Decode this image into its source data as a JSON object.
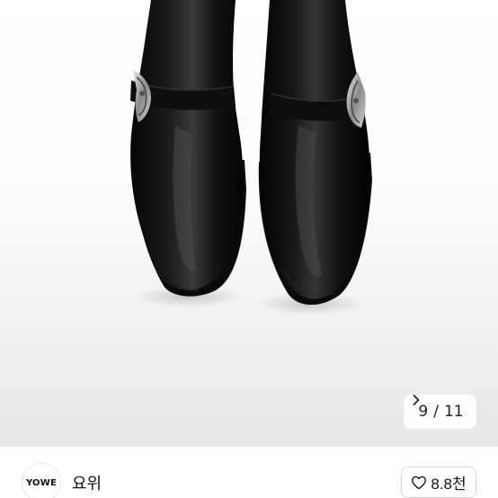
{
  "gallery": {
    "image_alt": "",
    "current": "9",
    "separator": "/",
    "total": "11",
    "next_icon": "chevron-right-icon"
  },
  "shop": {
    "logo_text": "YOWE",
    "name": "요위"
  },
  "like": {
    "icon": "heart-outline-icon",
    "count": "8.8천"
  }
}
